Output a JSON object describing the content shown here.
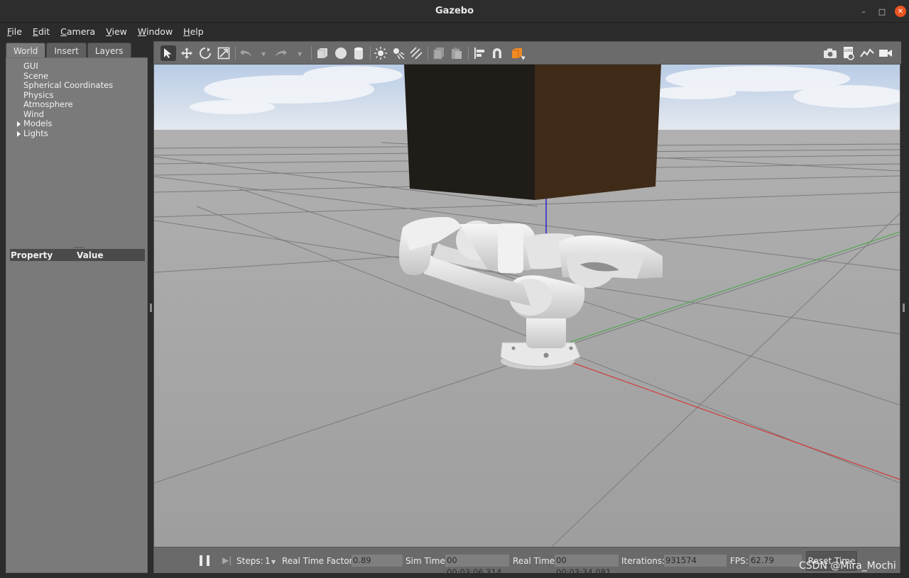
{
  "window": {
    "title": "Gazebo"
  },
  "menu": [
    {
      "key": "F",
      "rest": "ile"
    },
    {
      "key": "E",
      "rest": "dit"
    },
    {
      "key": "C",
      "rest": "amera"
    },
    {
      "key": "V",
      "rest": "iew"
    },
    {
      "key": "W",
      "rest": "indow"
    },
    {
      "key": "H",
      "rest": "elp"
    }
  ],
  "tabs": [
    "World",
    "Insert",
    "Layers"
  ],
  "tree": {
    "items": [
      "GUI",
      "Scene",
      "Spherical Coordinates",
      "Physics",
      "Atmosphere",
      "Wind",
      "Models",
      "Lights"
    ]
  },
  "properties": {
    "col_property": "Property",
    "col_value": "Value"
  },
  "bottom": {
    "steps_label": "Steps:",
    "steps_value": "1",
    "rtf_label": "Real Time Factor:",
    "rtf_value": "0.89",
    "sim_label": "Sim Time:",
    "sim_value": "00 00:03:06.314",
    "real_label": "Real Time:",
    "real_value": "00 00:03:34.081",
    "iter_label": "Iterations:",
    "iter_value": "931574",
    "fps_label": "FPS:",
    "fps_value": "62.79",
    "reset_label": "Reset Time"
  },
  "watermark": "CSDN @Mira_Mochi",
  "colors": {
    "accent_close": "#e95420",
    "ground": "#a3a3a3",
    "sky": "#c9d9ef",
    "box_dark": "#201c18",
    "box_brown": "#3f2b18",
    "axis_x": "#d43a3a",
    "axis_y": "#4fa84f",
    "axis_z": "#2626d0"
  },
  "toolbar_icons": [
    "select-arrow-icon",
    "translate-icon",
    "rotate-icon",
    "scale-icon",
    "undo-icon",
    "redo-icon",
    "box-icon",
    "sphere-icon",
    "cylinder-icon",
    "point-light-icon",
    "spot-light-icon",
    "directional-light-icon",
    "copy-icon",
    "paste-icon",
    "align-icon",
    "magnet-snap-icon",
    "change-view-icon",
    "screenshot-icon",
    "log-icon",
    "plot-icon",
    "video-icon"
  ]
}
